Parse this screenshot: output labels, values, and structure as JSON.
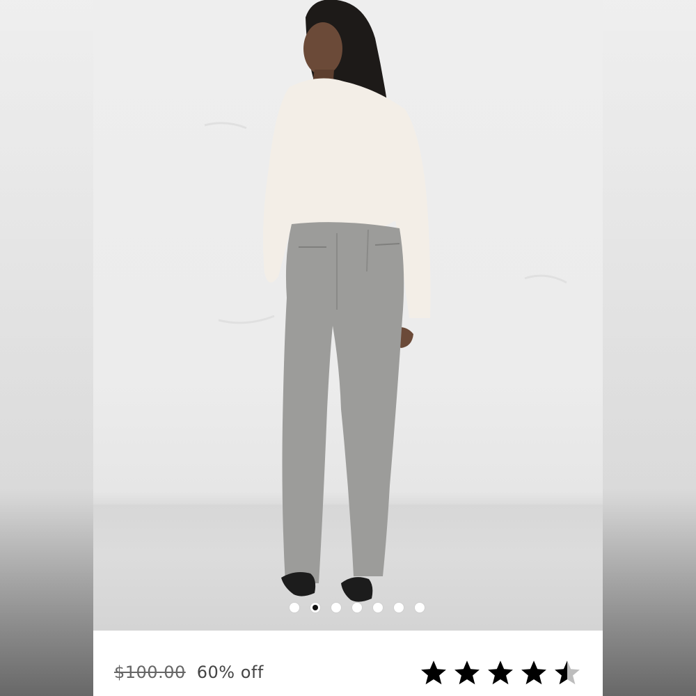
{
  "product": {
    "original_price": "$100.00",
    "discount": "60% off",
    "rating": 4.5,
    "rating_max": 5
  },
  "carousel": {
    "count": 7,
    "active_index": 1
  },
  "colors": {
    "star": "#000000",
    "star_empty": "#bdbdbd",
    "info_background": "#ffffff"
  }
}
